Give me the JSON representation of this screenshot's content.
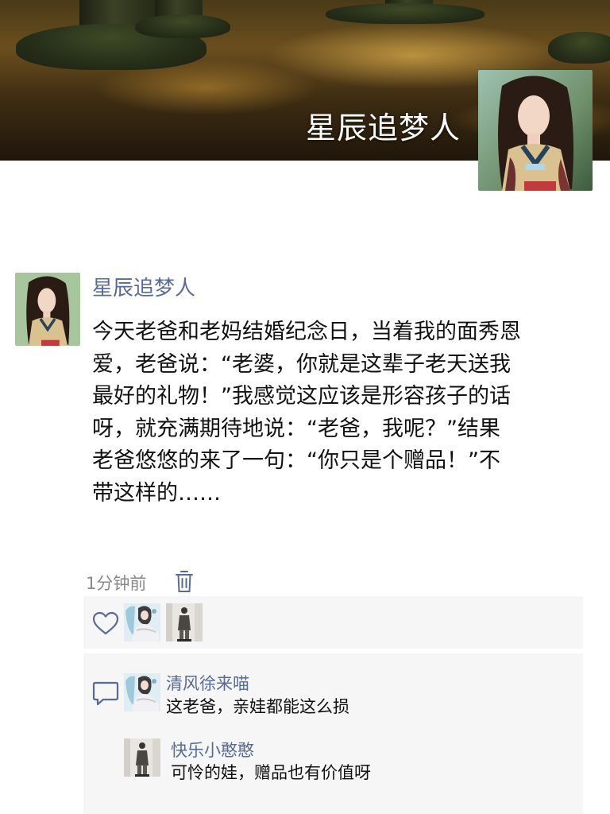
{
  "cover": {
    "username": "星辰追梦人",
    "avatar_icon": "user-avatar-hanbok-woman"
  },
  "post": {
    "author": "星辰追梦人",
    "avatar_icon": "user-avatar-hanbok-woman",
    "text_lines": [
      "今天老爸和老妈结婚纪念日，当着我的面秀恩",
      "爱，老爸说：“老婆，你就是这辈子老天送我",
      "最好的礼物！”我感觉这应该是形容孩子的话",
      "呀，就充满期待地说：“老爸，我呢？”结果",
      "老爸悠悠的来了一句：“你只是个赠品！”不",
      "带这样的……"
    ],
    "time": "1分钟前",
    "delete_icon": "trash-icon"
  },
  "likes": {
    "icon": "heart-outline-icon",
    "avatars": [
      "user-avatar-anime-girl",
      "user-avatar-standing-person"
    ]
  },
  "comments": {
    "icon": "comment-bubble-icon",
    "items": [
      {
        "name": "清风徐来喵",
        "text": "这老爸，亲娃都能这么损",
        "avatar": "user-avatar-anime-girl"
      },
      {
        "name": "快乐小憨憨",
        "text": "可怜的娃，赠品也有价值呀",
        "avatar": "user-avatar-standing-person"
      }
    ]
  },
  "colors": {
    "link": "#576b95",
    "text": "#111111",
    "muted": "#888888",
    "panel": "#f6f6f6"
  }
}
